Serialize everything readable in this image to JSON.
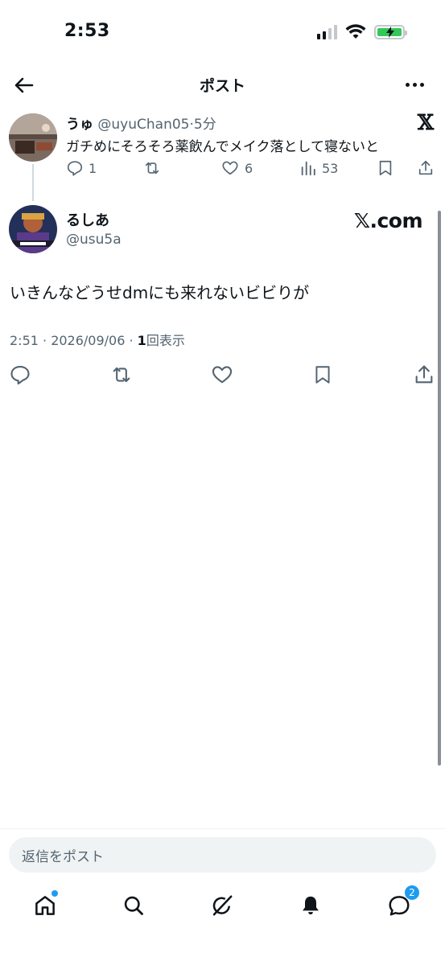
{
  "status": {
    "time": "2:53"
  },
  "header": {
    "title": "ポスト"
  },
  "parent_post": {
    "name": "うゅ",
    "handle": "@uyuChan05",
    "time_sep": "·",
    "time": "5分",
    "text": "ガチめにそろそろ薬飲んでメイク落として寝ないと",
    "replies": "1",
    "likes": "6",
    "views": "53",
    "x_logo": "𝕏"
  },
  "main_post": {
    "name": "るしあ",
    "handle": "@usu5a",
    "source_logo": "𝕏.com",
    "text": "いきんなどうせdmにも来れないビビりが",
    "meta_time": "2:51 · 2026/09/06 · ",
    "meta_views_count": "1",
    "meta_views_label": "回表示"
  },
  "reply": {
    "placeholder": "返信をポスト"
  },
  "tabbar": {
    "messages_badge": "2"
  },
  "colors": {
    "accent": "#1d9bf0",
    "text": "#0f1419",
    "muted": "#536471",
    "battery": "#34c759"
  },
  "icons": [
    "back-arrow-icon",
    "more-icon",
    "reply-icon",
    "repost-icon",
    "like-icon",
    "views-icon",
    "bookmark-icon",
    "share-icon",
    "home-icon",
    "search-icon",
    "grok-icon",
    "bell-icon",
    "messages-icon"
  ]
}
